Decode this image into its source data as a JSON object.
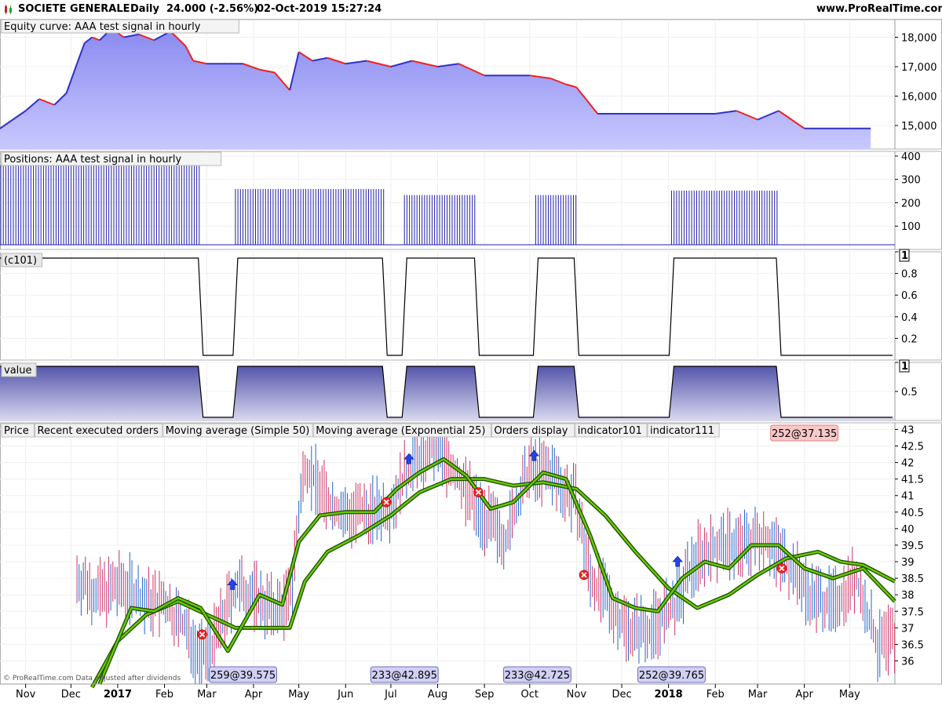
{
  "header": {
    "instrument": "SOCIETE GENERALE",
    "period": "Daily",
    "quote": "24.000 (-2.56%)",
    "datetime": "02-Oct-2019 15:27:24",
    "site": "www.ProRealTime.com"
  },
  "copyright": "© ProRealTime.com  Data adjusted after dividends",
  "colors": {
    "equity_line_up": "#3030cc",
    "equity_line_down": "#ee2222",
    "equity_fill_top": "#8a8af0",
    "equity_fill_bottom": "#c8c8ff",
    "positions": "#2222aa",
    "signal": "#000000",
    "value_fill": "#5555aa",
    "price_up": "#2266cc",
    "price_down": "#cc3366",
    "ma": "#66cc00",
    "buy_arrow": "#2244ee",
    "sell_x": "#ee2222",
    "title_red": "#ee2222",
    "title_blue": "#2233cc",
    "title_green": "#66bb00"
  },
  "chart_data": [
    {
      "type": "area",
      "title": "Equity curve: AAA test signal in hourly",
      "x_axis": "time",
      "ylim": [
        14200,
        18600
      ],
      "yticks": [
        15000,
        16000,
        17000,
        18000
      ],
      "ytick_labels": [
        "15,000",
        "16,000",
        "17,000",
        "18,000"
      ],
      "x": [
        "2016-10-01",
        "2016-10-15",
        "2016-11-01",
        "2016-11-10",
        "2016-11-20",
        "2016-11-28",
        "2016-12-05",
        "2016-12-10",
        "2016-12-15",
        "2016-12-20",
        "2016-12-28",
        "2017-01-05",
        "2017-01-15",
        "2017-01-25",
        "2017-02-05",
        "2017-02-15",
        "2017-02-20",
        "2017-03-01",
        "2017-03-15",
        "2017-03-25",
        "2017-04-05",
        "2017-04-15",
        "2017-04-25",
        "2017-05-01",
        "2017-05-10",
        "2017-05-20",
        "2017-06-01",
        "2017-06-15",
        "2017-07-01",
        "2017-07-15",
        "2017-08-01",
        "2017-08-15",
        "2017-09-01",
        "2017-09-15",
        "2017-10-01",
        "2017-10-15",
        "2017-10-25",
        "2017-11-01",
        "2017-11-15",
        "2017-12-01",
        "2017-12-15",
        "2018-01-01",
        "2018-01-15",
        "2018-02-01",
        "2018-02-15",
        "2018-03-01",
        "2018-03-15",
        "2018-04-01",
        "2018-04-15",
        "2018-05-01",
        "2018-05-15"
      ],
      "values": [
        14300,
        14900,
        15500,
        15900,
        15700,
        16100,
        17100,
        17800,
        18000,
        17900,
        18300,
        18000,
        18100,
        17900,
        18200,
        17700,
        17200,
        17100,
        17100,
        17100,
        16900,
        16800,
        16200,
        17500,
        17200,
        17300,
        17100,
        17200,
        17000,
        17200,
        17000,
        17100,
        16700,
        16700,
        16700,
        16600,
        16400,
        16300,
        15400,
        15400,
        15400,
        15400,
        15400,
        15400,
        15500,
        15200,
        15500,
        14900,
        14900,
        14900,
        14900
      ]
    },
    {
      "type": "bar",
      "title": "Positions: AAA test signal in hourly",
      "x_axis": "time",
      "ylim": [
        0,
        420
      ],
      "yticks": [
        100,
        200,
        300,
        400
      ],
      "ytick_labels": [
        "100",
        "200",
        "300",
        "400"
      ],
      "blocks": [
        {
          "start": "2016-10-01",
          "end": "2017-02-25",
          "value": 360
        },
        {
          "start": "2017-03-20",
          "end": "2017-06-27",
          "value": 259
        },
        {
          "start": "2017-07-10",
          "end": "2017-08-27",
          "value": 233
        },
        {
          "start": "2017-10-05",
          "end": "2017-11-01",
          "value": 233
        },
        {
          "start": "2018-01-03",
          "end": "2018-03-15",
          "value": 252
        }
      ]
    },
    {
      "type": "line",
      "title": "(c101)",
      "x_axis": "time",
      "ylim": [
        0,
        1
      ],
      "yticks": [
        0.2,
        0.4,
        0.6,
        0.8,
        1
      ],
      "ytick_labels": [
        "0.2",
        "0.4",
        "0.6",
        "0.8",
        "1"
      ],
      "highlight_label": "1",
      "segments": [
        {
          "start": "2016-10-01",
          "end": "2017-02-25",
          "value": 1
        },
        {
          "start": "2017-02-25",
          "end": "2017-03-20",
          "value": 0
        },
        {
          "start": "2017-03-20",
          "end": "2017-06-27",
          "value": 1
        },
        {
          "start": "2017-06-27",
          "end": "2017-07-10",
          "value": 0
        },
        {
          "start": "2017-07-10",
          "end": "2017-08-27",
          "value": 1
        },
        {
          "start": "2017-08-27",
          "end": "2017-10-05",
          "value": 0
        },
        {
          "start": "2017-10-05",
          "end": "2017-11-01",
          "value": 1
        },
        {
          "start": "2017-11-01",
          "end": "2018-01-03",
          "value": 0
        },
        {
          "start": "2018-01-03",
          "end": "2018-03-15",
          "value": 1
        },
        {
          "start": "2018-03-15",
          "end": "2018-05-31",
          "value": 0
        }
      ]
    },
    {
      "type": "area",
      "title": "value",
      "x_axis": "time",
      "ylim": [
        0,
        1
      ],
      "yticks": [
        0.5,
        1
      ],
      "ytick_labels": [
        "0.5",
        "1"
      ],
      "highlight_label": "1",
      "segments": [
        {
          "start": "2016-10-01",
          "end": "2017-02-25",
          "value": 1
        },
        {
          "start": "2017-02-25",
          "end": "2017-03-20",
          "value": 0
        },
        {
          "start": "2017-03-20",
          "end": "2017-06-27",
          "value": 1
        },
        {
          "start": "2017-06-27",
          "end": "2017-07-10",
          "value": 0
        },
        {
          "start": "2017-07-10",
          "end": "2017-08-27",
          "value": 1
        },
        {
          "start": "2017-08-27",
          "end": "2017-10-05",
          "value": 0
        },
        {
          "start": "2017-10-05",
          "end": "2017-11-01",
          "value": 1
        },
        {
          "start": "2017-11-01",
          "end": "2018-01-03",
          "value": 0
        },
        {
          "start": "2018-01-03",
          "end": "2018-03-15",
          "value": 1
        },
        {
          "start": "2018-03-15",
          "end": "2018-05-31",
          "value": 0
        }
      ]
    },
    {
      "type": "line",
      "title": "Price",
      "x_axis": "time",
      "ylim": [
        35.3,
        43.2
      ],
      "yticks": [
        36,
        36.5,
        37,
        37.5,
        38,
        38.5,
        39,
        39.5,
        40,
        40.5,
        41,
        41.5,
        42,
        42.5,
        43
      ],
      "ytick_labels": [
        "36",
        "36.5",
        "37",
        "37.5",
        "38",
        "38.5",
        "39",
        "39.5",
        "40",
        "40.5",
        "41",
        "41.5",
        "42",
        "42.5",
        "43"
      ],
      "legend": [
        "Price",
        "Recent executed orders",
        "Moving average (Simple 50)",
        "Moving average (Exponential 25)",
        "Orders display",
        "indicator101",
        "indicator111"
      ],
      "price_path": {
        "x": [
          "2016-12-05",
          "2016-12-20",
          "2017-01-05",
          "2017-01-20",
          "2017-02-01",
          "2017-02-15",
          "2017-02-25",
          "2017-03-05",
          "2017-03-20",
          "2017-04-01",
          "2017-04-15",
          "2017-04-25",
          "2017-05-05",
          "2017-05-20",
          "2017-06-01",
          "2017-06-20",
          "2017-07-01",
          "2017-07-15",
          "2017-08-01",
          "2017-08-15",
          "2017-09-01",
          "2017-09-15",
          "2017-10-01",
          "2017-10-15",
          "2017-11-01",
          "2017-11-10",
          "2017-11-25",
          "2017-12-05",
          "2017-12-20",
          "2018-01-05",
          "2018-01-20",
          "2018-02-05",
          "2018-02-20",
          "2018-03-05",
          "2018-03-20",
          "2018-04-05",
          "2018-04-20",
          "2018-05-05",
          "2018-05-20",
          "2018-05-31"
        ],
        "values": [
          38.5,
          38.0,
          38.3,
          37.8,
          37.7,
          37.0,
          36.1,
          36.5,
          38.2,
          38.0,
          37.5,
          37.8,
          42.0,
          40.8,
          40.4,
          40.5,
          40.7,
          42.0,
          42.5,
          41.5,
          40.3,
          39.7,
          41.8,
          41.7,
          40.8,
          38.5,
          37.6,
          37.0,
          37.0,
          37.6,
          39.2,
          39.5,
          39.5,
          39.8,
          39.0,
          38.0,
          37.7,
          38.5,
          36.4,
          36.7
        ]
      },
      "sma50": {
        "x": [
          "2016-12-15",
          "2017-01-01",
          "2017-01-20",
          "2017-02-10",
          "2017-03-01",
          "2017-03-20",
          "2017-04-10",
          "2017-04-25",
          "2017-05-05",
          "2017-05-20",
          "2017-06-10",
          "2017-07-01",
          "2017-07-20",
          "2017-08-10",
          "2017-09-01",
          "2017-09-20",
          "2017-10-10",
          "2017-11-01",
          "2017-11-20",
          "2017-12-10",
          "2018-01-01",
          "2018-01-20",
          "2018-02-10",
          "2018-03-01",
          "2018-03-20",
          "2018-04-10",
          "2018-04-25",
          "2018-05-10",
          "2018-05-31"
        ],
        "values": [
          35.2,
          36.6,
          37.4,
          37.8,
          37.4,
          37.0,
          37.0,
          37.0,
          38.4,
          39.3,
          39.8,
          40.4,
          41.1,
          41.5,
          41.5,
          41.3,
          41.4,
          41.2,
          40.4,
          39.3,
          38.2,
          37.6,
          38.0,
          38.6,
          39.1,
          39.3,
          39.0,
          38.9,
          38.4
        ]
      },
      "ema25": {
        "x": [
          "2016-12-20",
          "2017-01-10",
          "2017-01-25",
          "2017-02-10",
          "2017-02-25",
          "2017-03-15",
          "2017-04-05",
          "2017-04-20",
          "2017-05-01",
          "2017-05-15",
          "2017-06-01",
          "2017-06-20",
          "2017-07-05",
          "2017-07-20",
          "2017-08-05",
          "2017-08-20",
          "2017-09-05",
          "2017-09-20",
          "2017-10-10",
          "2017-10-25",
          "2017-11-10",
          "2017-11-25",
          "2017-12-10",
          "2017-12-25",
          "2018-01-10",
          "2018-01-25",
          "2018-02-10",
          "2018-02-25",
          "2018-03-15",
          "2018-04-01",
          "2018-04-20",
          "2018-05-10",
          "2018-05-31"
        ],
        "values": [
          35.3,
          37.6,
          37.5,
          37.9,
          37.6,
          36.3,
          38.0,
          37.7,
          39.6,
          40.4,
          40.5,
          40.5,
          41.2,
          41.7,
          42.1,
          41.6,
          40.6,
          40.8,
          41.7,
          41.5,
          39.8,
          37.9,
          37.6,
          37.5,
          38.5,
          39.0,
          38.8,
          39.5,
          39.5,
          38.8,
          38.5,
          38.8,
          37.8
        ]
      },
      "buy_markers": [
        {
          "x": "2017-03-18",
          "y": 38.3
        },
        {
          "x": "2017-07-13",
          "y": 42.1
        },
        {
          "x": "2017-10-04",
          "y": 42.2
        },
        {
          "x": "2018-01-07",
          "y": 39.0
        }
      ],
      "sell_markers": [
        {
          "x": "2017-02-26",
          "y": 36.8
        },
        {
          "x": "2017-06-28",
          "y": 40.8
        },
        {
          "x": "2017-08-28",
          "y": 41.1
        },
        {
          "x": "2017-11-06",
          "y": 38.6
        },
        {
          "x": "2018-03-17",
          "y": 38.8
        }
      ],
      "order_labels": [
        {
          "text": "259@39.575",
          "x": "2017-03-25"
        },
        {
          "text": "233@42.895",
          "x": "2017-07-10"
        },
        {
          "text": "233@42.725",
          "x": "2017-10-06"
        },
        {
          "text": "252@39.765",
          "x": "2018-01-03"
        },
        {
          "text": "252@37.135",
          "x": "2018-04-01",
          "top": true
        }
      ]
    }
  ],
  "x_axis": {
    "labels": [
      {
        "text": "Nov",
        "x": "2016-11-01"
      },
      {
        "text": "Dec",
        "x": "2016-12-01"
      },
      {
        "text": "2017",
        "x": "2017-01-01",
        "bold": true
      },
      {
        "text": "Feb",
        "x": "2017-02-01"
      },
      {
        "text": "Mar",
        "x": "2017-03-01"
      },
      {
        "text": "Apr",
        "x": "2017-04-01"
      },
      {
        "text": "May",
        "x": "2017-05-01"
      },
      {
        "text": "Jun",
        "x": "2017-06-01"
      },
      {
        "text": "Jul",
        "x": "2017-07-01"
      },
      {
        "text": "Aug",
        "x": "2017-08-01"
      },
      {
        "text": "Sep",
        "x": "2017-09-01"
      },
      {
        "text": "Oct",
        "x": "2017-10-01"
      },
      {
        "text": "Nov",
        "x": "2017-11-01"
      },
      {
        "text": "Dec",
        "x": "2017-12-01"
      },
      {
        "text": "2018",
        "x": "2018-01-01",
        "bold": true
      },
      {
        "text": "Feb",
        "x": "2018-02-01"
      },
      {
        "text": "Mar",
        "x": "2018-03-01"
      },
      {
        "text": "Apr",
        "x": "2018-04-01"
      },
      {
        "text": "May",
        "x": "2018-05-01"
      }
    ],
    "range": [
      "2016-10-15",
      "2018-05-31"
    ]
  }
}
